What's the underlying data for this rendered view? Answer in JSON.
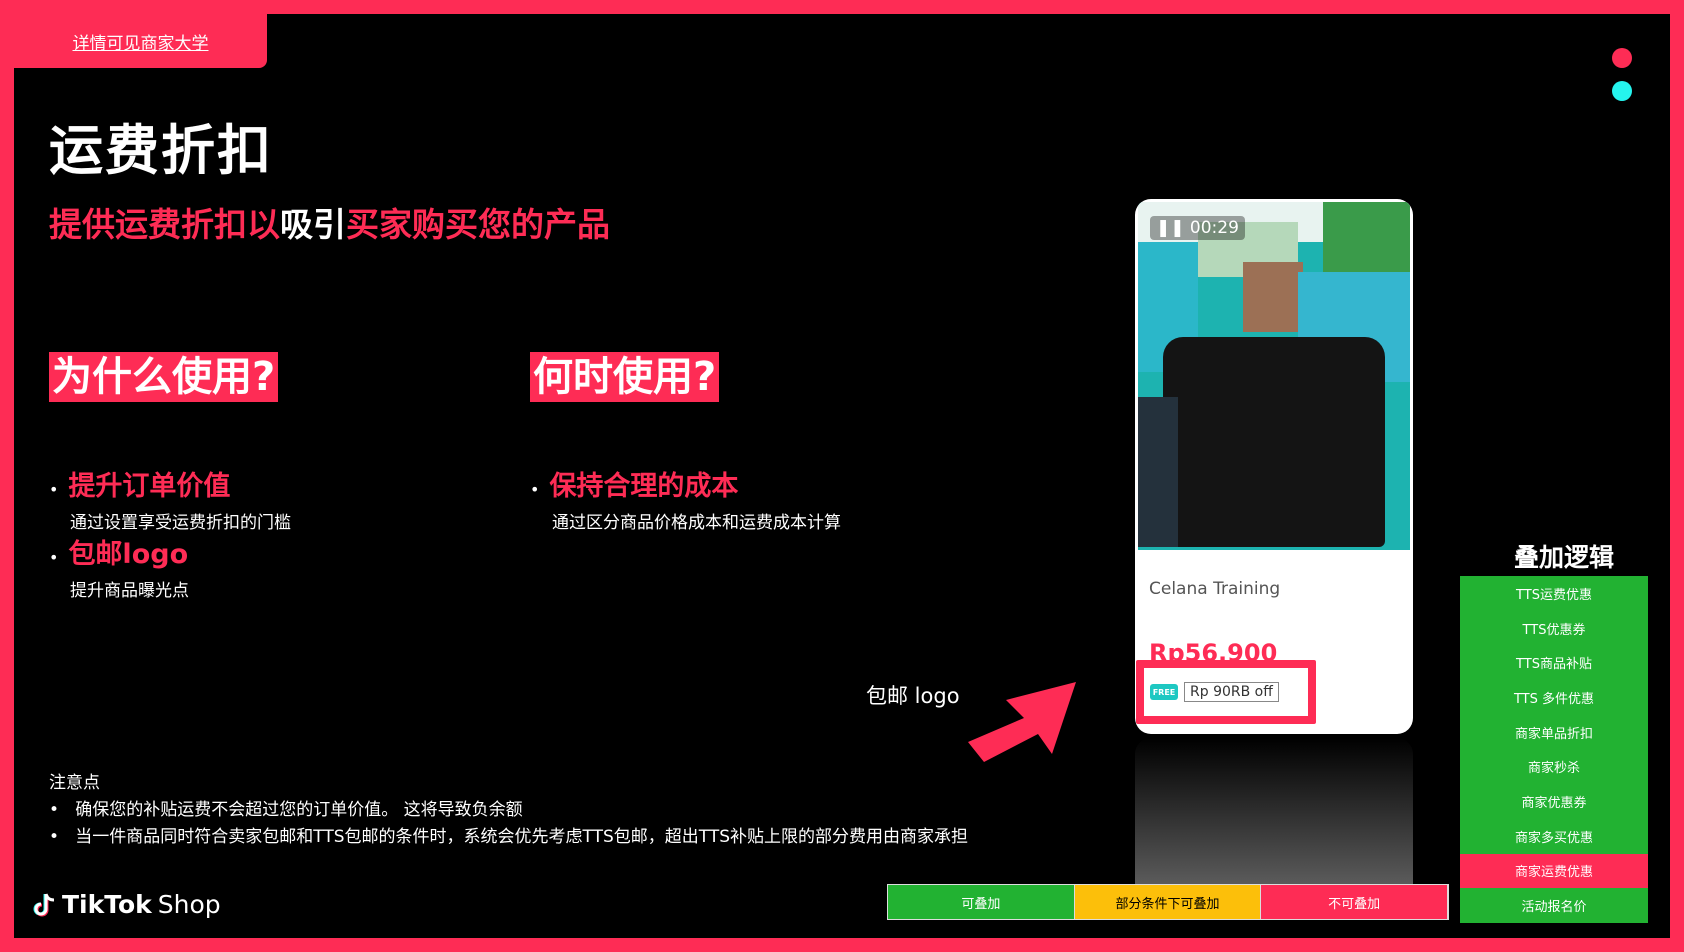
{
  "header": {
    "tab_label": "详情可见商家大学"
  },
  "title": "运费折扣",
  "subtitle": {
    "part1": "提供运费折扣以",
    "part2": "吸引",
    "part3": "买家购买您的产品"
  },
  "sections": {
    "why": {
      "heading": "为什么使用?",
      "items": [
        {
          "head": "提升订单价值",
          "desc": "通过设置享受运费折扣的门槛"
        },
        {
          "head": "包邮logo",
          "desc": "提升商品曝光点"
        }
      ]
    },
    "when": {
      "heading": "何时使用?",
      "items": [
        {
          "head": "保持合理的成本",
          "desc": "通过区分商品价格成本和运费成本计算"
        }
      ]
    }
  },
  "notes": {
    "title": "注意点",
    "lines": [
      "确保您的补贴运费不会超过您的订单价值。 这将导致负余额",
      "当一件商品同时符合卖家包邮和TTS包邮的条件时，系统会优先考虑TTS包邮，超出TTS补贴上限的部分费用由商家承担"
    ]
  },
  "phone": {
    "timer": "00:29",
    "product_title": "Celana Training",
    "price": "Rp56.900",
    "badge_free": "FREE",
    "badge_off": "Rp 90RB off"
  },
  "arrow_label": "包邮 logo",
  "legend": {
    "title": "叠加逻辑",
    "items": [
      {
        "label": "TTS运费优惠",
        "color": "#22b232"
      },
      {
        "label": "TTS优惠券",
        "color": "#22b232"
      },
      {
        "label": "TTS商品补贴",
        "color": "#22b232"
      },
      {
        "label": "TTS 多件优惠",
        "color": "#22b232"
      },
      {
        "label": "商家单品折扣",
        "color": "#22b232"
      },
      {
        "label": "商家秒杀",
        "color": "#22b232"
      },
      {
        "label": "商家优惠券",
        "color": "#22b232"
      },
      {
        "label": "商家多买优惠",
        "color": "#22b232"
      },
      {
        "label": "商家运费优惠",
        "color": "#fe2c55"
      },
      {
        "label": "活动报名价",
        "color": "#22b232"
      }
    ]
  },
  "stack_bar": [
    {
      "label": "可叠加",
      "color": "#22b232",
      "text_color": "#ffffff"
    },
    {
      "label": "部分条件下可叠加",
      "color": "#fcbf0a",
      "text_color": "#000000"
    },
    {
      "label": "不可叠加",
      "color": "#fe2c55",
      "text_color": "#ffffff"
    }
  ],
  "brand": {
    "name": "TikTok",
    "suffix": "Shop"
  },
  "colors": {
    "accent": "#fe2c55",
    "cyan": "#25f4ee",
    "green": "#22b232",
    "yellow": "#fcbf0a"
  }
}
